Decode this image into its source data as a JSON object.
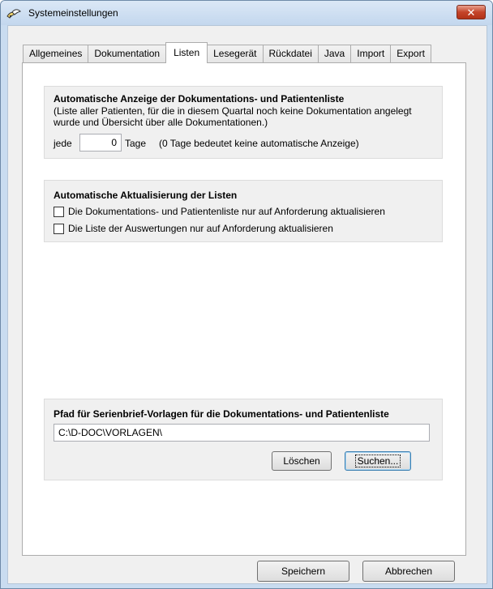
{
  "window": {
    "title": "Systemeinstellungen",
    "close_glyph": "✕"
  },
  "tabs": [
    {
      "label": "Allgemeines",
      "active": false
    },
    {
      "label": "Dokumentation",
      "active": false
    },
    {
      "label": "Listen",
      "active": true
    },
    {
      "label": "Lesegerät",
      "active": false
    },
    {
      "label": "Rückdatei",
      "active": false
    },
    {
      "label": "Java",
      "active": false
    },
    {
      "label": "Import",
      "active": false
    },
    {
      "label": "Export",
      "active": false
    }
  ],
  "auto_display": {
    "title": "Automatische Anzeige der Dokumentations- und Patientenliste",
    "description": "(Liste aller Patienten, für die in diesem Quartal noch keine Dokumentation angelegt wurde und Übersicht über alle Dokumentationen.)",
    "prefix": "jede",
    "days_value": "0",
    "suffix": "Tage",
    "hint": "(0 Tage bedeutet keine automatische Anzeige)"
  },
  "auto_refresh": {
    "title": "Automatische Aktualisierung der Listen",
    "option1_label": "Die Dokumentations- und Patientenliste nur auf Anforderung aktualisieren",
    "option1_checked": false,
    "option2_label": "Die Liste der Auswertungen nur auf Anforderung aktualisieren",
    "option2_checked": false
  },
  "template_path": {
    "title": "Pfad für Serienbrief-Vorlagen für die Dokumentations- und Patientenliste",
    "value": "C:\\D-DOC\\VORLAGEN\\",
    "delete_label": "Löschen",
    "search_label": "Suchen..."
  },
  "footer": {
    "save_label": "Speichern",
    "cancel_label": "Abbrechen"
  }
}
